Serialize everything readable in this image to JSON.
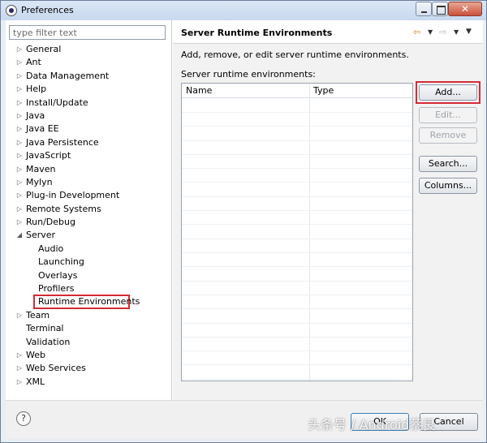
{
  "window": {
    "title": "Preferences",
    "icon": "eclipse-icon",
    "close_glyph": "✕"
  },
  "filter": {
    "placeholder": "type filter text"
  },
  "tree": {
    "items": [
      {
        "label": "General",
        "expander": "▷"
      },
      {
        "label": "Ant",
        "expander": "▷"
      },
      {
        "label": "Data Management",
        "expander": "▷"
      },
      {
        "label": "Help",
        "expander": "▷"
      },
      {
        "label": "Install/Update",
        "expander": "▷"
      },
      {
        "label": "Java",
        "expander": "▷"
      },
      {
        "label": "Java EE",
        "expander": "▷"
      },
      {
        "label": "Java Persistence",
        "expander": "▷"
      },
      {
        "label": "JavaScript",
        "expander": "▷"
      },
      {
        "label": "Maven",
        "expander": "▷"
      },
      {
        "label": "Mylyn",
        "expander": "▷"
      },
      {
        "label": "Plug-in Development",
        "expander": "▷"
      },
      {
        "label": "Remote Systems",
        "expander": "▷"
      },
      {
        "label": "Run/Debug",
        "expander": "▷"
      },
      {
        "label": "Server",
        "expander": "◢"
      },
      {
        "label": "Audio"
      },
      {
        "label": "Launching"
      },
      {
        "label": "Overlays"
      },
      {
        "label": "Profilers"
      },
      {
        "label": "Runtime Environments",
        "selected": true
      },
      {
        "label": "Team",
        "expander": "▷"
      },
      {
        "label": "Terminal"
      },
      {
        "label": "Validation"
      },
      {
        "label": "Web",
        "expander": "▷"
      },
      {
        "label": "Web Services",
        "expander": "▷"
      },
      {
        "label": "XML",
        "expander": "▷"
      }
    ]
  },
  "page": {
    "title": "Server Runtime Environments",
    "description": "Add, remove, or edit server runtime environments.",
    "list_label": "Server runtime environments:",
    "nav": {
      "back": "⇦",
      "forward": "⇨",
      "dropdown": "▼",
      "menu": "▼"
    }
  },
  "table": {
    "columns": [
      "Name",
      "Type"
    ],
    "rows": []
  },
  "buttons": {
    "add": "Add...",
    "edit": "Edit...",
    "remove": "Remove",
    "search": "Search...",
    "columns": "Columns..."
  },
  "dialog": {
    "help": "?",
    "ok": "OK",
    "cancel": "Cancel"
  },
  "watermark": "头条号 / Android蔡艮",
  "colors": {
    "highlight": "#d42b35",
    "title_bar": "#c7d8ee"
  }
}
